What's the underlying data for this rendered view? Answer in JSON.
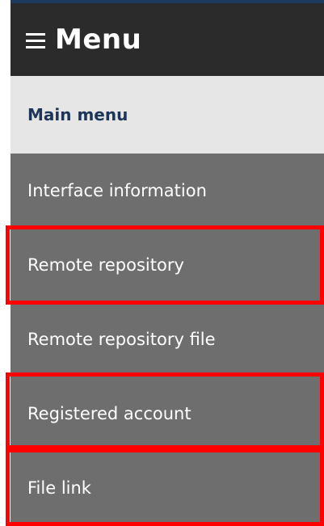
{
  "header": {
    "menu_icon": "hamburger-icon",
    "title": "Menu",
    "accent_color": "#1f3a5f"
  },
  "main_menu": {
    "label": "Main menu"
  },
  "items": [
    {
      "label": "Interface information",
      "highlighted": false
    },
    {
      "label": "Remote repository",
      "highlighted": true
    },
    {
      "label": "Remote repository file",
      "highlighted": false
    },
    {
      "label": "Registered account",
      "highlighted": true
    },
    {
      "label": "File link",
      "highlighted": true
    }
  ],
  "highlight_color": "#ff0000"
}
